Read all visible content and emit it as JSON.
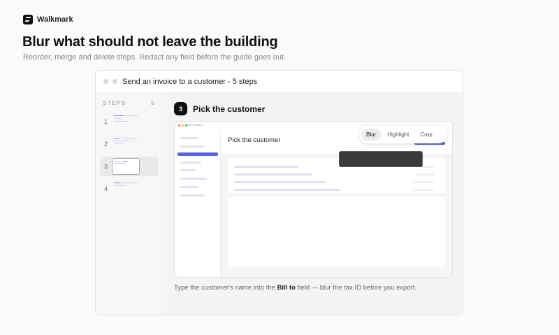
{
  "brand": {
    "name": "Walkmark",
    "logo_icon": "walkmark-logo-icon"
  },
  "hero": {
    "headline": "Blur what should not leave the building",
    "subline": "Reorder, merge and delete steps. Redact any field before the guide goes out."
  },
  "window": {
    "title": "Send an invoice to a customer - 5 steps",
    "steps_label": "STEPS",
    "steps_count": "5",
    "steps": [
      {
        "number": "1"
      },
      {
        "number": "2"
      },
      {
        "number": "3",
        "active": true
      },
      {
        "number": "4"
      }
    ]
  },
  "current_step": {
    "number": "3",
    "title": "Pick the customer",
    "screenshot": {
      "app_name": "Acme Billing",
      "heading": "Pick the customer",
      "redacted": true
    },
    "tools": [
      {
        "label": "Blur",
        "active": true
      },
      {
        "label": "Highlight",
        "active": false
      },
      {
        "label": "Crop",
        "active": false
      }
    ],
    "caption_before": "Type the customer's name into the ",
    "caption_bold": "Bill to",
    "caption_after": " field — blur the tax ID before you export."
  },
  "colors": {
    "accent": "#5b63e6",
    "redaction": "#3a3a3a",
    "text_primary": "#111111",
    "text_muted": "#888888"
  }
}
